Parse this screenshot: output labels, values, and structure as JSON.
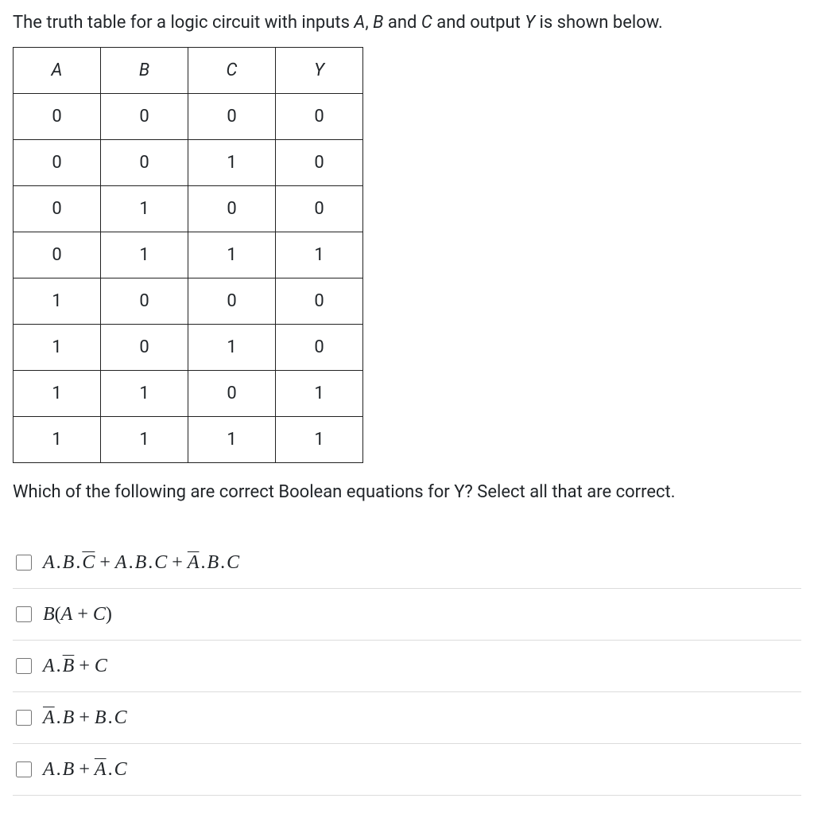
{
  "question": {
    "intro_pre": "The truth table for a logic circuit with inputs ",
    "var_a": "A",
    "sep1": ", ",
    "var_b": "B",
    "sep2": " and ",
    "var_c": "C",
    "sep3": " and output ",
    "var_y": "Y",
    "intro_post": " is shown below."
  },
  "table": {
    "headers": [
      "A",
      "B",
      "C",
      "Y"
    ],
    "rows": [
      [
        "0",
        "0",
        "0",
        "0"
      ],
      [
        "0",
        "0",
        "1",
        "0"
      ],
      [
        "0",
        "1",
        "0",
        "0"
      ],
      [
        "0",
        "1",
        "1",
        "1"
      ],
      [
        "1",
        "0",
        "0",
        "0"
      ],
      [
        "1",
        "0",
        "1",
        "0"
      ],
      [
        "1",
        "1",
        "0",
        "1"
      ],
      [
        "1",
        "1",
        "1",
        "1"
      ]
    ]
  },
  "prompt": "Which of the following are correct Boolean equations for Y? Select all that are correct.",
  "options": {
    "o1": {
      "t1": "A",
      "dot1": ".",
      "t2": "B",
      "dot2": ".",
      "t3": "C",
      "plus1": "+",
      "t4": "A",
      "dot3": ".",
      "t5": "B",
      "dot4": ".",
      "t6": "C",
      "plus2": "+",
      "t7": "A",
      "dot5": ".",
      "t8": "B",
      "dot6": ".",
      "t9": "C"
    },
    "o2": {
      "t1": "B",
      "p1": "(",
      "t2": "A",
      "plus1": "+",
      "t3": "C",
      "p2": ")"
    },
    "o3": {
      "t1": "A",
      "dot1": ".",
      "t2": "B",
      "plus1": "+",
      "t3": "C"
    },
    "o4": {
      "t1": "A",
      "dot1": ".",
      "t2": "B",
      "plus1": "+",
      "t3": "B",
      "dot2": ".",
      "t4": "C"
    },
    "o5": {
      "t1": "A",
      "dot1": ".",
      "t2": "B",
      "plus1": "+",
      "t3": "A",
      "dot2": ".",
      "t4": "C"
    }
  }
}
